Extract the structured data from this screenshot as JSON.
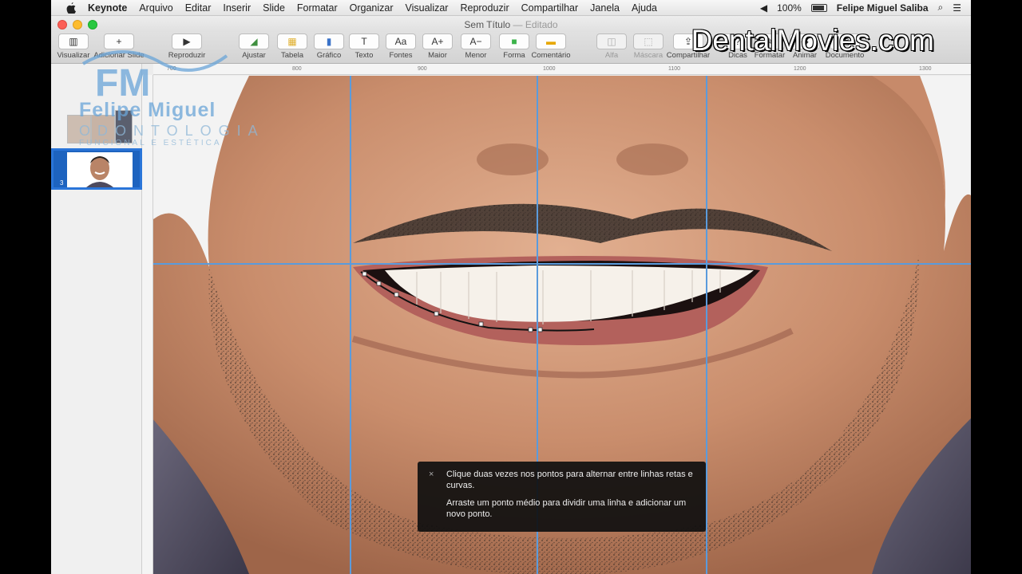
{
  "menubar": {
    "app_name": "Keynote",
    "items": [
      "Arquivo",
      "Editar",
      "Inserir",
      "Slide",
      "Formatar",
      "Organizar",
      "Visualizar",
      "Reproduzir",
      "Compartilhar",
      "Janela",
      "Ajuda"
    ],
    "battery": "100%",
    "user": "Felipe Miguel Saliba"
  },
  "window": {
    "title": "Sem Título",
    "status": "Editado"
  },
  "toolbar": {
    "left_labels": [
      "Visualizar",
      "Adicionar Slide"
    ],
    "buttons": [
      {
        "label": "Reproduzir",
        "icon": "play-icon"
      },
      {
        "label": "Ajustar",
        "icon": "adjust-icon"
      },
      {
        "label": "Tabela",
        "icon": "table-icon"
      },
      {
        "label": "Gráfico",
        "icon": "chart-icon"
      },
      {
        "label": "Texto",
        "icon": "text-icon"
      },
      {
        "label": "Fontes",
        "icon": "fonts-icon"
      },
      {
        "label": "Maior",
        "icon": "font-bigger-icon"
      },
      {
        "label": "Menor",
        "icon": "font-smaller-icon"
      },
      {
        "label": "Forma",
        "icon": "shape-icon"
      },
      {
        "label": "Comentário",
        "icon": "comment-icon"
      },
      {
        "label": "Alfa",
        "icon": "alpha-icon"
      },
      {
        "label": "Máscara",
        "icon": "mask-icon"
      },
      {
        "label": "Compartilhar",
        "icon": "share-icon"
      },
      {
        "label": "Dicas",
        "icon": "tips-icon"
      },
      {
        "label": "Formatar",
        "icon": "format-icon"
      },
      {
        "label": "Animar",
        "icon": "animate-icon"
      },
      {
        "label": "Documento",
        "icon": "document-icon"
      }
    ]
  },
  "ruler": {
    "ticks": [
      "700",
      "800",
      "900",
      "1000",
      "1100",
      "1200",
      "1300"
    ]
  },
  "navigator": {
    "selected_slide": "3"
  },
  "tooltip": {
    "close": "×",
    "line1": "Clique duas vezes nos pontos para alternar entre linhas retas e curvas.",
    "line2": "Arraste um ponto médio para dividir uma linha e adicionar um novo ponto."
  },
  "overlays": {
    "watermark": "DentalMovies.com",
    "logo_name": "Felipe Miguel",
    "logo_line2": "ODONTOLOGIA",
    "logo_line3": "FUNCIONAL E ESTÉTICA"
  },
  "colors": {
    "guide": "#5a9bdc",
    "selection": "#2a75d9"
  }
}
